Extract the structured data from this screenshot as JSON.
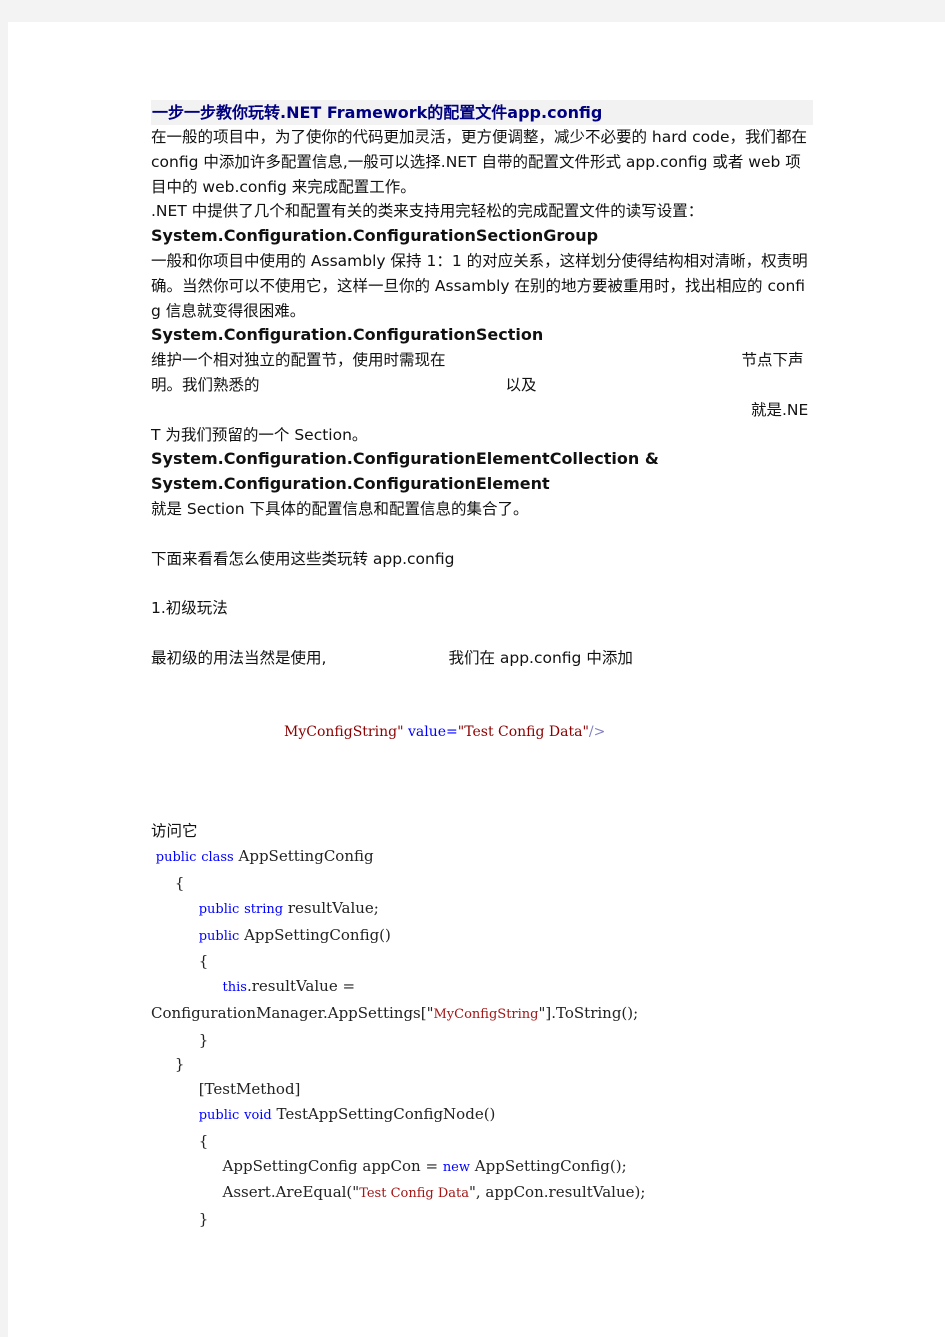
{
  "title": "一步一步教你玩转.NET Framework的配置文件app.config",
  "paragraphs": {
    "intro": "在一般的项目中，为了使你的代码更加灵活，更方便调整，减少不必要的 hard code，我们都在 config 中添加许多配置信息,一般可以选择.NET 自带的配置文件形式 app.config 或者 web 项目中的 web.config 来完成配置工作。",
    "classes_intro": ".NET 中提供了几个和配置有关的类来支持用完轻松的完成配置文件的读写设置：",
    "section_group_heading": "System.Configuration.ConfigurationSectionGroup",
    "section_group_desc": "一般和你项目中使用的 Assambly 保持 1：1 的对应关系，这样划分使得结构相对清晰，权责明确。当然你可以不使用它，这样一旦你的 Assambly 在别的地方要被重用时，找出相应的 config 信息就变得很困难。",
    "section_heading": "System.Configuration.ConfigurationSection",
    "section_desc_part1": "维护一个相对独立的配置节，使用时需现在",
    "section_desc_part2": "节点下声明。我们熟悉的",
    "section_desc_part3": "以及",
    "section_desc_part4": "就是.NET 为我们预留的一个 Section。",
    "element_heading_1": "System.Configuration.ConfigurationElementCollection &",
    "element_heading_2": "System.Configuration.ConfigurationElement",
    "element_desc": "就是 Section 下具体的配置信息和配置信息的集合了。",
    "how_to_use": "下面来看看怎么使用这些类玩转 app.config",
    "level1_heading": "1.初级玩法",
    "level1_desc_part1": "最初级的用法当然是使用,",
    "level1_desc_part2": "我们在 app.config  中添加",
    "access_it": "访问它"
  },
  "xml_snippet": {
    "key_value": "MyConfigString",
    "quote": "\"",
    "attr": "value",
    "eq": "=",
    "value": "Test Config Data",
    "close": "/>"
  },
  "code": {
    "l1_kw1": "public",
    "l1_kw2": "class",
    "l1_text": "AppSettingConfig",
    "l2": "{",
    "l3_kw1": "public",
    "l3_kw2": "string",
    "l3_text": "resultValue;",
    "l4_kw": "public",
    "l4_text": "AppSettingConfig()",
    "l5": "{",
    "l6_kw": "this",
    "l6_text": ".resultValue =",
    "l7_pre": "ConfigurationManager.AppSettings[\"",
    "l7_str": "MyConfigString",
    "l7_post": "\"].ToString();",
    "l8": "}",
    "l9": "}",
    "l10": "[TestMethod]",
    "l11_kw1": "public",
    "l11_kw2": "void",
    "l11_text": "TestAppSettingConfigNode()",
    "l12": "{",
    "l13_pre": "AppSettingConfig appCon = ",
    "l13_kw": "new",
    "l13_post": " AppSettingConfig();",
    "l14_pre": "Assert.AreEqual(\"",
    "l14_str": "Test Config Data",
    "l14_post": "\", appCon.resultValue);",
    "l15": "}"
  }
}
